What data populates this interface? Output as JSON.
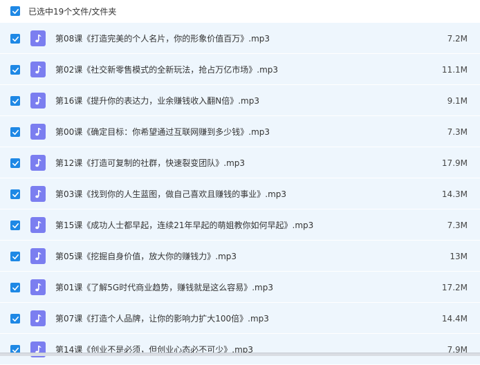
{
  "header": {
    "selection_label": "已选中19个文件/文件夹"
  },
  "files": [
    {
      "name": "第08课《打造完美的个人名片，你的形象价值百万》.mp3",
      "size": "7.2M"
    },
    {
      "name": "第02课《社交新零售模式的全新玩法，抢占万亿市场》.mp3",
      "size": "11.1M"
    },
    {
      "name": "第16课《提升你的表达力，业余赚钱收入翻N倍》.mp3",
      "size": "9.1M"
    },
    {
      "name": "第00课《确定目标：你希望通过互联网赚到多少钱》.mp3",
      "size": "7.3M"
    },
    {
      "name": "第12课《打造可复制的社群，快速裂变团队》.mp3",
      "size": "17.9M"
    },
    {
      "name": "第03课《找到你的人生蓝图，做自己喜欢且赚钱的事业》.mp3",
      "size": "14.3M"
    },
    {
      "name": "第15课《成功人士都早起，连续21年早起的萌姐教你如何早起》.mp3",
      "size": "7.3M"
    },
    {
      "name": "第05课《挖掘自身价值，放大你的赚钱力》.mp3",
      "size": "13M"
    },
    {
      "name": "第01课《了解5G时代商业趋势，赚钱就是这么容易》.mp3",
      "size": "17.2M"
    },
    {
      "name": "第07课《打造个人品牌，让你的影响力扩大100倍》.mp3",
      "size": "14.4M"
    },
    {
      "name": "第14课《创业不是必须，但创业心态必不可少》.mp3",
      "size": "7.9M"
    }
  ],
  "colors": {
    "checkbox": "#1e88e5",
    "row_bg": "#eef6fd",
    "audio_icon": "#7b7ef0"
  },
  "icons": {
    "checkbox": "checkmark-icon",
    "file": "music-note-icon"
  }
}
